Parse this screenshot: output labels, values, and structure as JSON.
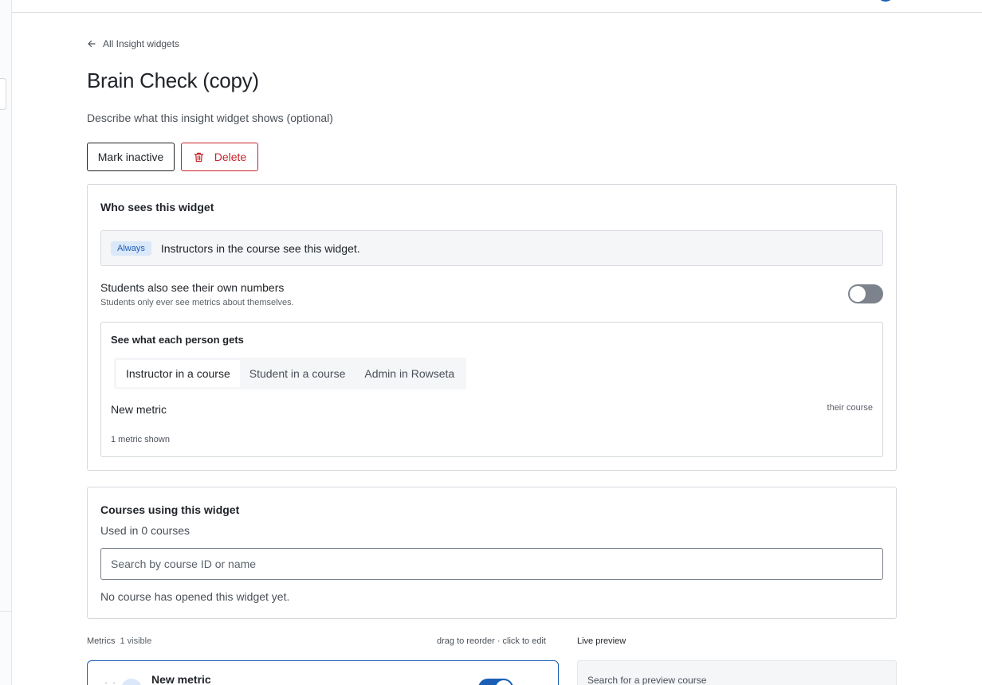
{
  "nav": {
    "back_label": "All Insight widgets"
  },
  "widget": {
    "title": "Brain Check (copy)",
    "description_placeholder": "Describe what this insight widget shows (optional)"
  },
  "actions": {
    "mark_inactive_label": "Mark inactive",
    "delete_label": "Delete"
  },
  "who_sees": {
    "title": "Who sees this widget",
    "always_badge": "Always",
    "always_text": "Instructors in the course see this widget.",
    "students_label": "Students also see their own numbers",
    "students_sub": "Students only ever see metrics about themselves.",
    "students_toggle": false
  },
  "per_person": {
    "title": "See what each person gets",
    "tabs": [
      {
        "label": "Instructor in a course",
        "active": true
      },
      {
        "label": "Student in a course",
        "active": false
      },
      {
        "label": "Admin in Rowseta",
        "active": false
      }
    ],
    "metric_name": "New metric",
    "metric_scope": "their course",
    "metric_count": "1 metric shown"
  },
  "courses": {
    "title": "Courses using this widget",
    "used_in": "Used in 0 courses",
    "search_placeholder": "Search by course ID or name",
    "empty_text": "No course has opened this widget yet."
  },
  "metrics": {
    "label": "Metrics",
    "visible": "1 visible",
    "hint": "drag to reorder · click to edit",
    "items": [
      {
        "name": "New metric",
        "enabled": true
      }
    ]
  },
  "preview": {
    "label": "Live preview",
    "search_placeholder": "Search for a preview course"
  },
  "colors": {
    "accent": "#1a5fb4",
    "danger": "#c8232c",
    "border": "#d4d8dd"
  }
}
